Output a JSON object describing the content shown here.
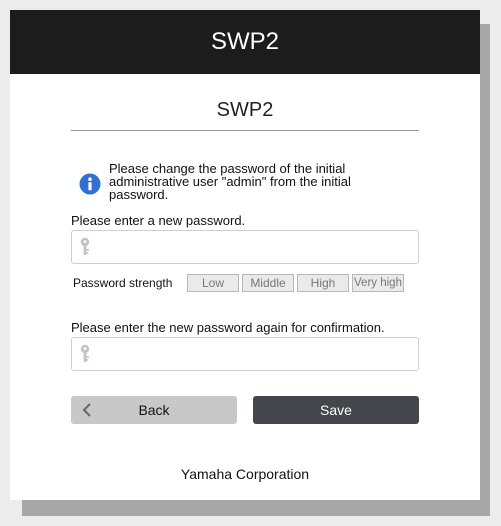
{
  "header": {
    "title": "SWP2"
  },
  "subtitle": "SWP2",
  "notice": {
    "icon": "info-icon",
    "line1": "Please change the password of the initial",
    "line2": "administrative user \"admin\" from the initial",
    "line3": "password."
  },
  "new_password": {
    "label": "Please enter a new password.",
    "value": "",
    "icon": "key-icon"
  },
  "strength": {
    "label": "Password strength",
    "levels": [
      "Low",
      "Middle",
      "High",
      "Very high"
    ]
  },
  "confirm_password": {
    "label": "Please enter the new password again for confirmation.",
    "value": "",
    "icon": "key-icon"
  },
  "buttons": {
    "back": "Back",
    "save": "Save"
  },
  "footer": "Yamaha Corporation",
  "colors": {
    "header_bg": "#1c1c1c",
    "info_blue": "#2f6fd6",
    "save_bg": "#45464b",
    "back_bg": "#c8c8c8"
  }
}
